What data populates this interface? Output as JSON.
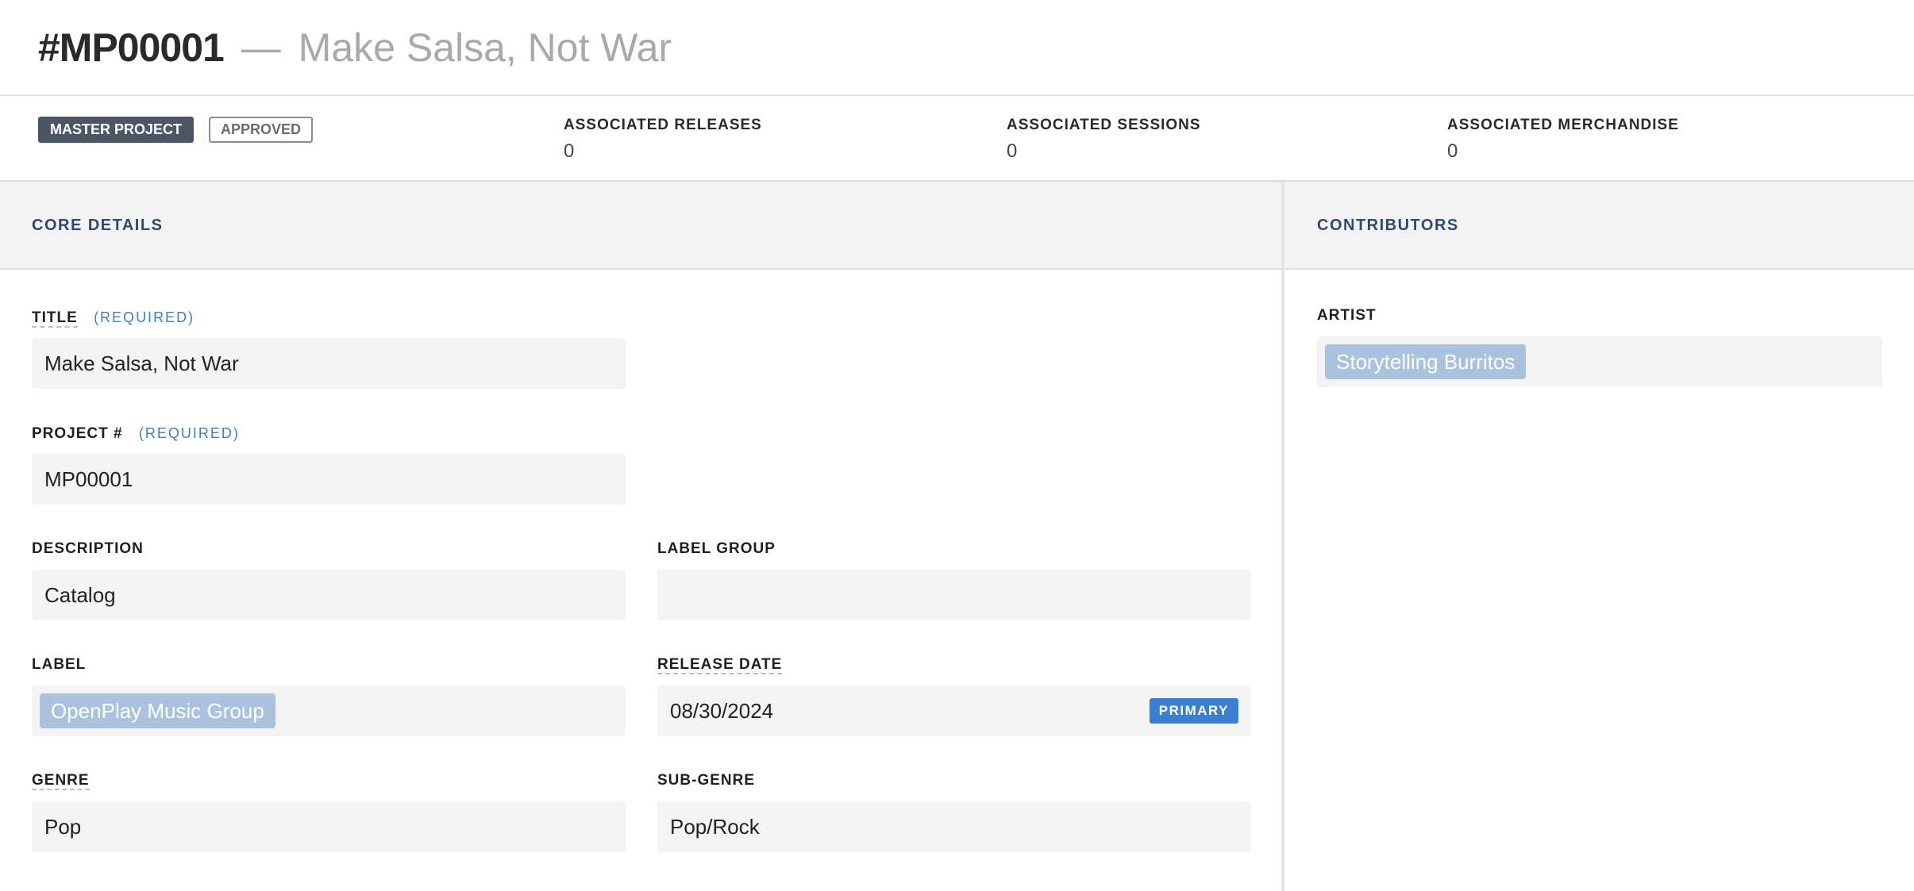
{
  "header": {
    "code": "#MP00001",
    "separator": "—",
    "name": "Make Salsa, Not War"
  },
  "summary": {
    "badges": {
      "type": "MASTER PROJECT",
      "status": "APPROVED"
    },
    "stats": [
      {
        "label": "ASSOCIATED RELEASES",
        "value": "0"
      },
      {
        "label": "ASSOCIATED SESSIONS",
        "value": "0"
      },
      {
        "label": "ASSOCIATED MERCHANDISE",
        "value": "0"
      }
    ]
  },
  "core_details": {
    "heading": "CORE DETAILS",
    "required_text": "(REQUIRED)",
    "title": {
      "label": "TITLE",
      "value": "Make Salsa, Not War"
    },
    "project_number": {
      "label": "PROJECT #",
      "value": "MP00001"
    },
    "description": {
      "label": "DESCRIPTION",
      "value": "Catalog"
    },
    "label_group": {
      "label": "LABEL GROUP",
      "value": ""
    },
    "label": {
      "label": "LABEL",
      "chip": "OpenPlay Music Group"
    },
    "release_date": {
      "label": "RELEASE DATE",
      "value": "08/30/2024",
      "tag": "PRIMARY"
    },
    "genre": {
      "label": "GENRE",
      "value": "Pop"
    },
    "sub_genre": {
      "label": "SUB-GENRE",
      "value": "Pop/Rock"
    }
  },
  "contributors": {
    "heading": "CONTRIBUTORS",
    "artist": {
      "label": "ARTIST",
      "chip": "Storytelling Burritos"
    }
  },
  "colors": {
    "accent_blue": "#3b7fd1",
    "heading_navy": "#2c4a6e",
    "chip_bg": "#a9c3de",
    "badge_dark": "#4b5563"
  }
}
